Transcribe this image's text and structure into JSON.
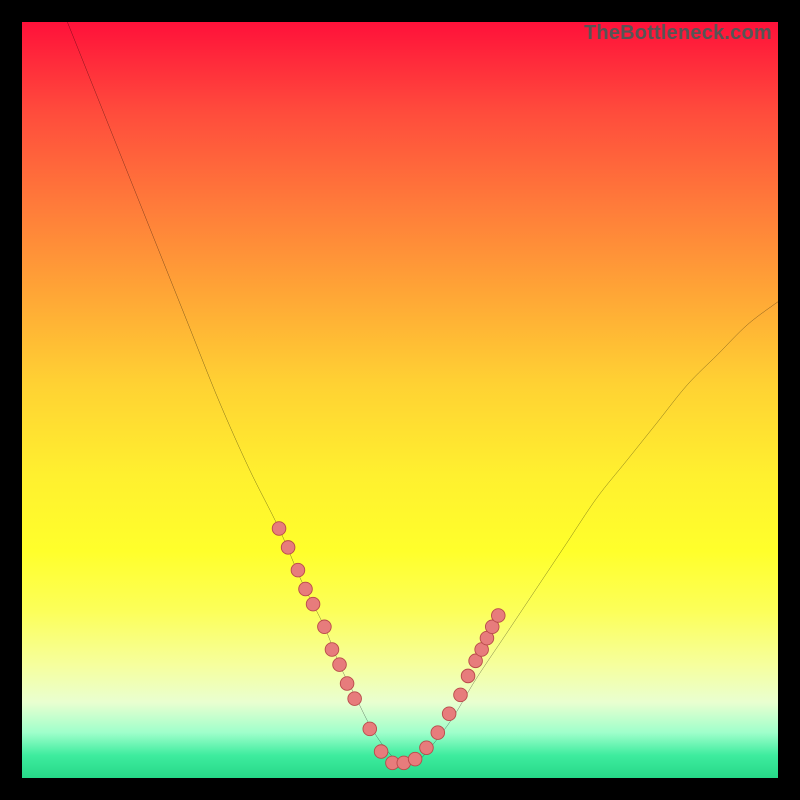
{
  "watermark": "TheBottleneck.com",
  "colors": {
    "frame": "#000000",
    "curve_stroke": "#000000",
    "dot_fill": "#e77c7c",
    "dot_stroke": "#b94a4a",
    "gradient_top": "#ff113a",
    "gradient_bottom": "#26d888"
  },
  "chart_data": {
    "type": "line",
    "title": "",
    "xlabel": "",
    "ylabel": "",
    "xlim": [
      0,
      100
    ],
    "ylim": [
      0,
      100
    ],
    "series": [
      {
        "name": "bottleneck-curve",
        "x": [
          6,
          10,
          14,
          18,
          22,
          26,
          30,
          34,
          37,
          40,
          42,
          44,
          46,
          48,
          50,
          52,
          54,
          57,
          60,
          64,
          68,
          72,
          76,
          80,
          84,
          88,
          92,
          96,
          100
        ],
        "y": [
          100,
          90,
          80,
          70,
          60,
          50,
          41,
          33,
          26,
          20,
          15,
          11,
          7,
          4,
          2,
          2,
          4,
          8,
          13,
          19,
          25,
          31,
          37,
          42,
          47,
          52,
          56,
          60,
          63
        ]
      }
    ],
    "dots": {
      "name": "highlight-points",
      "x": [
        34.0,
        35.2,
        36.5,
        37.5,
        38.5,
        40.0,
        41.0,
        42.0,
        43.0,
        44.0,
        46.0,
        47.5,
        49.0,
        50.5,
        52.0,
        53.5,
        55.0,
        56.5,
        58.0,
        59.0,
        60.0,
        60.8,
        61.5,
        62.2,
        63.0
      ],
      "y": [
        33.0,
        30.5,
        27.5,
        25.0,
        23.0,
        20.0,
        17.0,
        15.0,
        12.5,
        10.5,
        6.5,
        3.5,
        2.0,
        2.0,
        2.5,
        4.0,
        6.0,
        8.5,
        11.0,
        13.5,
        15.5,
        17.0,
        18.5,
        20.0,
        21.5
      ]
    }
  }
}
